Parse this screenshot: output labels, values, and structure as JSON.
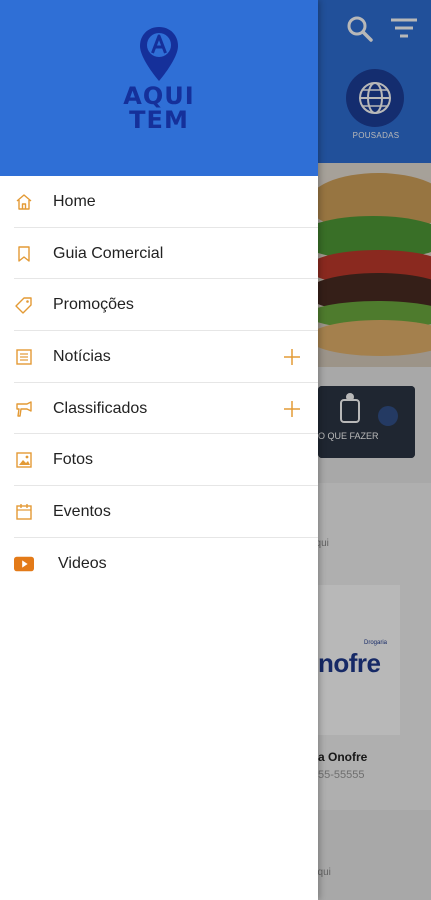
{
  "background": {
    "category_label": "POUSADAS",
    "card_label": "O QUE FAZER",
    "ad_text": "aqui",
    "logo_small": "Drogaria",
    "logo_word": "nofre",
    "business_name": "a Onofre",
    "phone": "55-55555",
    "ad_text2": "aqui"
  },
  "drawer": {
    "logo_line1": "AQUI",
    "logo_line2": "TEM",
    "accent_color": "#e39a35",
    "header_color": "#2f6fd6",
    "items": [
      {
        "label": "Home",
        "icon": "home-icon"
      },
      {
        "label": "Guia Comercial",
        "icon": "bookmark-icon"
      },
      {
        "label": "Promoções",
        "icon": "tag-icon"
      },
      {
        "label": "Notícias",
        "icon": "newspaper-icon",
        "expandable": true
      },
      {
        "label": "Classificados",
        "icon": "megaphone-icon",
        "expandable": true
      },
      {
        "label": "Fotos",
        "icon": "photo-icon"
      },
      {
        "label": "Eventos",
        "icon": "calendar-icon"
      },
      {
        "label": "Videos",
        "icon": "youtube-icon"
      }
    ]
  }
}
